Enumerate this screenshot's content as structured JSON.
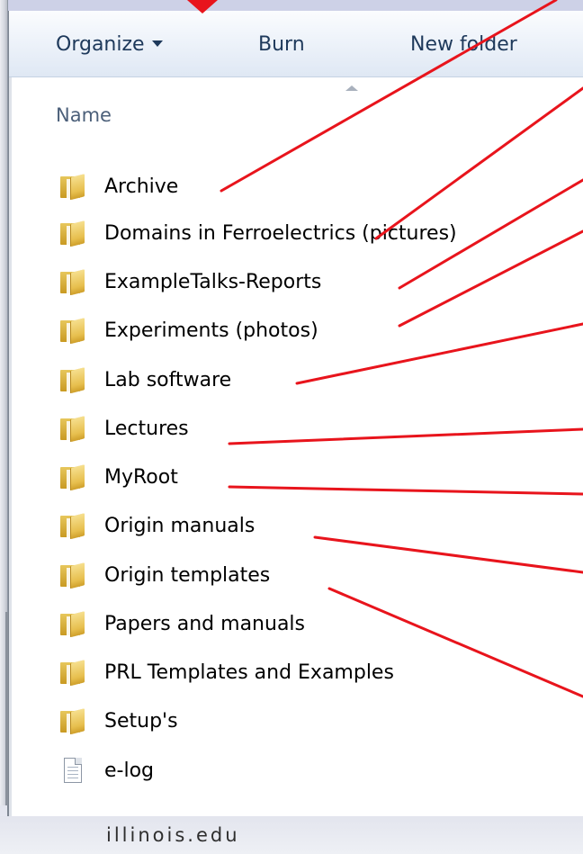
{
  "toolbar": {
    "organize_label": "Organize",
    "burn_label": "Burn",
    "new_folder_label": "New folder"
  },
  "list_header": {
    "name_label": "Name"
  },
  "files": [
    {
      "name": "Archive",
      "icon": "folder-icon"
    },
    {
      "name": "Domains in Ferroelectrics (pictures)",
      "icon": "folder-icon"
    },
    {
      "name": "ExampleTalks-Reports",
      "icon": "folder-icon"
    },
    {
      "name": "Experiments (photos)",
      "icon": "folder-icon"
    },
    {
      "name": "Lab software",
      "icon": "folder-icon"
    },
    {
      "name": "Lectures",
      "icon": "folder-icon"
    },
    {
      "name": "MyRoot",
      "icon": "folder-icon"
    },
    {
      "name": "Origin manuals",
      "icon": "folder-icon"
    },
    {
      "name": "Origin templates",
      "icon": "folder-icon"
    },
    {
      "name": "Papers and manuals",
      "icon": "folder-icon"
    },
    {
      "name": "PRL Templates and Examples",
      "icon": "folder-icon"
    },
    {
      "name": "Setup's",
      "icon": "folder-icon"
    },
    {
      "name": "e-log",
      "icon": "document-icon"
    }
  ],
  "footer": {
    "text": "illinois.edu"
  },
  "colors": {
    "annotation_line": "#e8141c",
    "toolbar_text": "#1e395b",
    "header_text": "#4c607a",
    "slide_background": "#c9cde3"
  }
}
